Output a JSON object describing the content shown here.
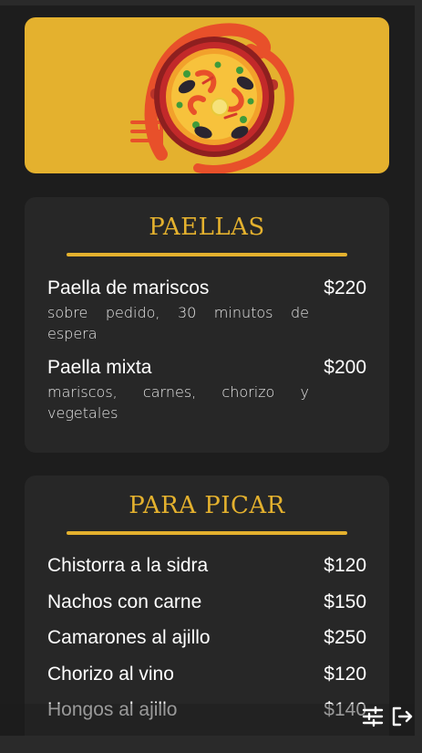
{
  "hero": {
    "image": "paella-pan-illustration"
  },
  "sections": [
    {
      "title": "PAELLAS",
      "items": [
        {
          "name": "Paella de mariscos",
          "price": "$220",
          "desc": "sobre pedido, 30 minutos de espera"
        },
        {
          "name": "Paella mixta",
          "price": "$200",
          "desc": "mariscos, carnes, chorizo y vegetales"
        }
      ]
    },
    {
      "title": "PARA PICAR",
      "items": [
        {
          "name": "Chistorra a la sidra",
          "price": "$120"
        },
        {
          "name": "Nachos con carne",
          "price": "$150"
        },
        {
          "name": "Camarones al ajillo",
          "price": "$250"
        },
        {
          "name": "Chorizo al vino",
          "price": "$120"
        },
        {
          "name": "Hongos al ajillo",
          "price": "$140"
        }
      ]
    }
  ],
  "controls": {
    "settings_icon": "sliders-icon",
    "exit_icon": "exit-icon"
  },
  "colors": {
    "accent": "#e4b12e",
    "background": "#1d1d1d",
    "card": "#272727"
  }
}
